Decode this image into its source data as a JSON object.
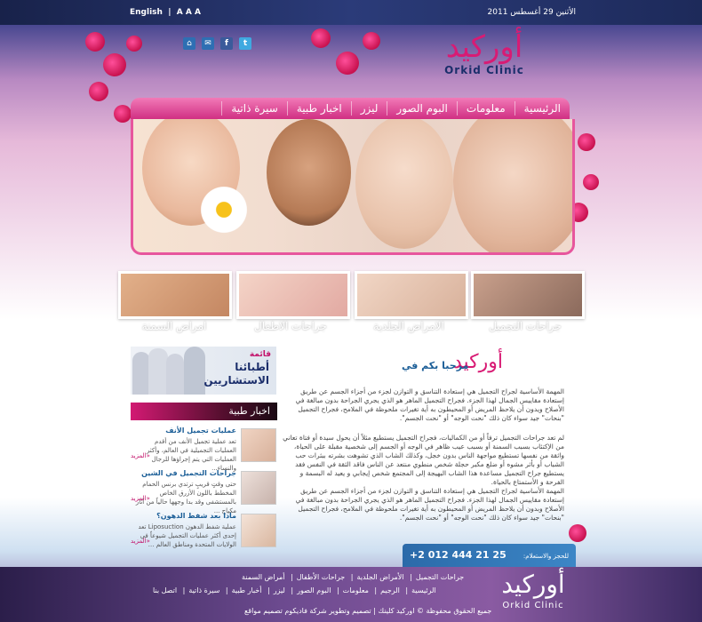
{
  "topbar": {
    "lang": "English",
    "textsize": "A A A",
    "date": "الأثنين 29 أغسطس 2011"
  },
  "social": {
    "home": "⌂",
    "mail": "✉",
    "facebook": "f",
    "twitter": "t"
  },
  "logo": {
    "ar": "أوركيد",
    "en": "Orkid Clinic"
  },
  "nav": [
    "الرئيسية",
    "معلومات",
    "البوم الصور",
    "ليزر",
    "اخبار طبية",
    "سيرة ذاتية"
  ],
  "thumbs": [
    "جراحات التجميل",
    "الامراض الجلدية",
    "جراحات الاطفال",
    "امراض السمنة"
  ],
  "consult": {
    "badge": "قائمة",
    "line1": "أطبائنا",
    "line2": "الاستشاريين"
  },
  "news_title": "اخبار طبية",
  "news": [
    {
      "title": "عمليات تجميل الأنف",
      "body": "تعد عملية تجميل الأنف من أقدم العمليات التجميلية في العالم، وأكثر العمليات التي يتم إجراؤها للرجال والنساء...",
      "more": "المزيد»"
    },
    {
      "title": "جراحات التجميل في الشين",
      "body": "حتى وقتٍ قريبٍ ترتدي برنس الحمام المخطط باللون الأزرق الخاص بالمستشفى وقد بدا وجهها حالياً من آثار مكياج ...",
      "more": "المزيد»"
    },
    {
      "title": "ماذا بعد شفط الدهون؟",
      "body": "عملية شفط الدهون Liposuction تعد إحدى أكثر عمليات التجميل شيوعاً في الولايات المتحدة ومناطق العالم ...",
      "more": "المزيد»"
    }
  ],
  "welcome": {
    "title": "مرحبا بكم في",
    "logo": "أوركيد"
  },
  "paragraphs": [
    "المهمة الأساسية لجراح التجميل هي إستعادة التناسق و التوازن لجزء من أجزاء الجسم عن طريق إستعادة مقاييس الجمال لهذا الجزء. فجراح التجميل الماهر هو الذي يجري الجراحة بدون مبالغة في الأصلاح ويدون أن يلاحظ المريض أو المحيطون به أية تغيرات ملحوظة في الملامح، فجراح التجميل \"بنحات\" جيد سواء كان ذلك \"نحت الوجه\" أو \"نحت الجسم\".",
    "لم تعد جراحات التجميل ترفاً أو من الكماليات، فجراح التجميل يستطيع مثلاً أن يحول سيدة أو فتاة تعاني من الإكتئاب بسبب السمنة أو بسبب عيب ظاهر في الوجه أو الجسم إلى شخصية مقبلة على الحياة، واثقة من نفسها تستطيع مواجهة الناس بدون خجل، وكذلك الشاب الذي تشوهت بشرته ببثرات حب الشباب أو بأثر مشوه أو ضلع مكبر حجلة شخص منطوي منتعد عن الناس فاقد الثقة في النفس فقد يستطيع جراح التجميل مساعدة هذا الشاب البهيجة إلى المجتمع شخص إيجابي و يعيد له البسمة و الفرحة و الأستمتاع بالحياة.",
    "المهمة الأساسية لجراح التجميل هي إستعادة التناسق و التوازن لجزء من أجزاء الجسم عن طريق إستعادة مقاييس الجمال لهذا الجزء. فجراح التجميل الماهر هو الذي يجري الجراحة بدون مبالغة في الأصلاح وبدون أن يلاحظ المريض أو المحيطون به أية تغيرات ملحوظة في الملامح، فجراح التجميل \"بنحات\" جيد سواء كان ذلك \"نحت الوجه\" أو \"نحت الجسم\"."
  ],
  "phone": {
    "label": "للحجز والاستعلام:",
    "number": "+2 012 444 21 25"
  },
  "footer": {
    "row1": [
      "جراحات التجميل",
      "الأمراض الجلدية",
      "جراحات الأطفال",
      "أمراض السمنة"
    ],
    "row2": [
      "الرئيسية",
      "الرجيم",
      "معلومات",
      "البوم الصور",
      "ليزر",
      "أخبار طبية",
      "سيرة ذاتية",
      "اتصل بنا"
    ],
    "copy1": "جميع الحقوق محفوظة © اوركيد كلينك",
    "copy2": "تصميم وتطوير شركة فاديكوم تصميم مواقع",
    "logo_ar": "أوركيد",
    "logo_en": "Orkid Clinic"
  },
  "colors": {
    "accent": "#d81b74",
    "nav": "#e0509b",
    "link": "#1b5e97"
  }
}
